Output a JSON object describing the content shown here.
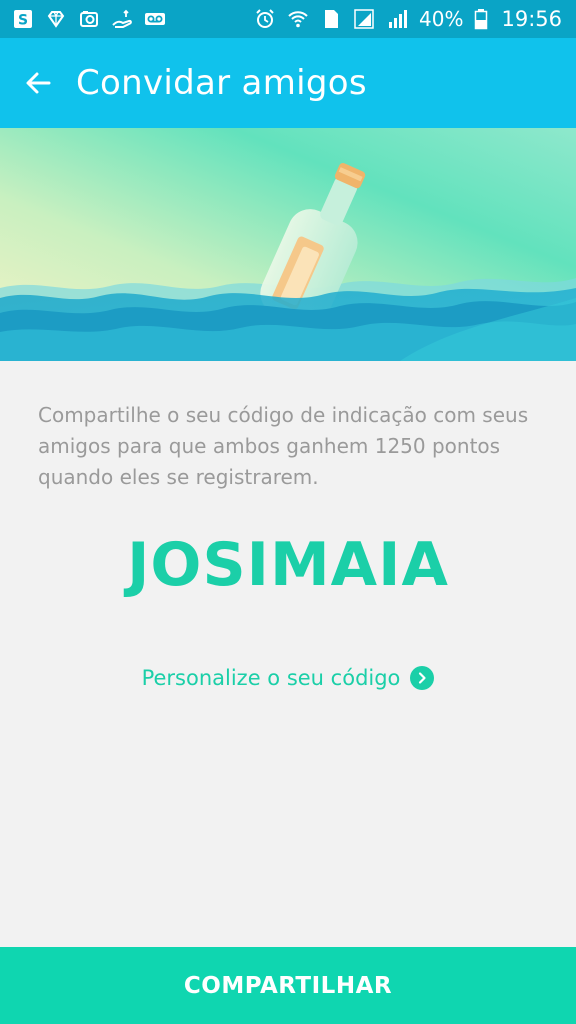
{
  "status_bar": {
    "left_icons": [
      "s-app-icon",
      "diamond-icon",
      "photo-icon",
      "hand-money-icon",
      "voicemail-icon"
    ],
    "right_icons": [
      "alarm-icon",
      "wifi-icon",
      "sim1-icon",
      "signal-icon",
      "signal2-icon",
      "battery-icon"
    ],
    "sim_label": "1",
    "battery": "40%",
    "time": "19:56"
  },
  "app_bar": {
    "title": "Convidar amigos",
    "back_icon": "arrow-left-icon"
  },
  "hero": {
    "illustration": "bottle-in-sea"
  },
  "content": {
    "description": "Compartilhe o seu código de indicação com seus amigos para que ambos ganhem 1250 pontos quando eles se registrarem.",
    "referral_code": "JOSIMAIA",
    "customize_label": "Personalize o seu código"
  },
  "footer": {
    "share_label": "COMPARTILHAR"
  },
  "colors": {
    "status_bar": "#0aa4c6",
    "app_bar": "#10c2ec",
    "accent": "#1bcfa8",
    "button": "#0fd6b0",
    "background": "#f2f2f2"
  }
}
